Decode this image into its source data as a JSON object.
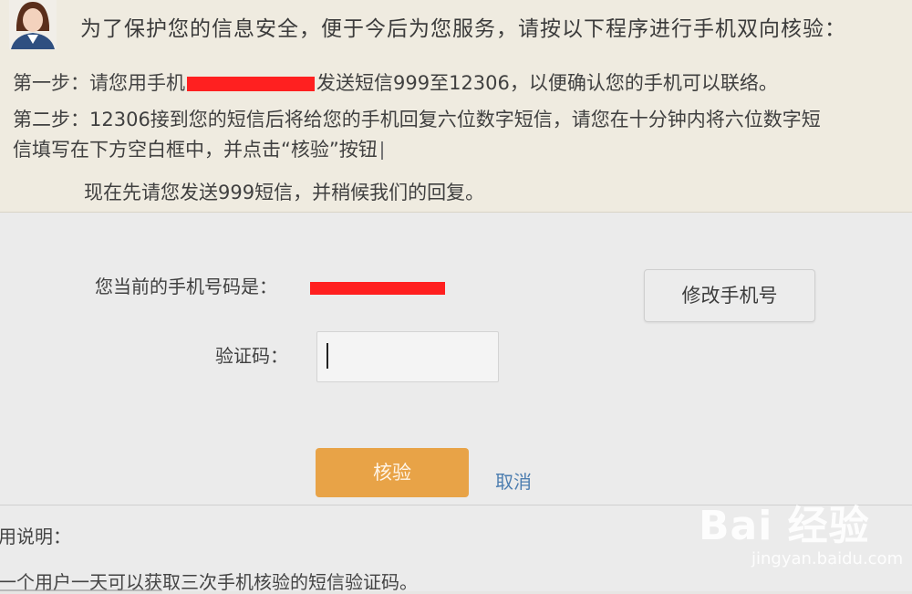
{
  "notice": {
    "title": "为了保护您的信息安全，便于今后为您服务，请按以下程序进行手机双向核验：",
    "step1_prefix": "第一步：请您用手机",
    "step1_suffix": "发送短信999至12306，以便确认您的手机可以联络。",
    "step2_line1": "第二步：12306接到您的短信后将给您的手机回复六位数字短信，请您在十分钟内将六位数字短",
    "step2_line2": "信填写在下方空白框中，并点击“核验”按钮",
    "wait_text": "现在先请您发送999短信，并稍候我们的回复。"
  },
  "form": {
    "phone_label": "您当前的手机号码是：",
    "change_phone_button": "修改手机号",
    "code_label": "验证码：",
    "code_value": "",
    "verify_button": "核验",
    "cancel_link": "取消"
  },
  "help": {
    "title": "用说明：",
    "line1": "一个用户一天可以获取三次手机核验的短信验证码。"
  },
  "watermark": {
    "logo": "Bai 经验",
    "url": "jingyan.baidu.com"
  },
  "colors": {
    "notice_bg": "#efebe0",
    "verify_button": "#e8a347",
    "redaction": "#ff2020",
    "link": "#4d7eb0"
  }
}
